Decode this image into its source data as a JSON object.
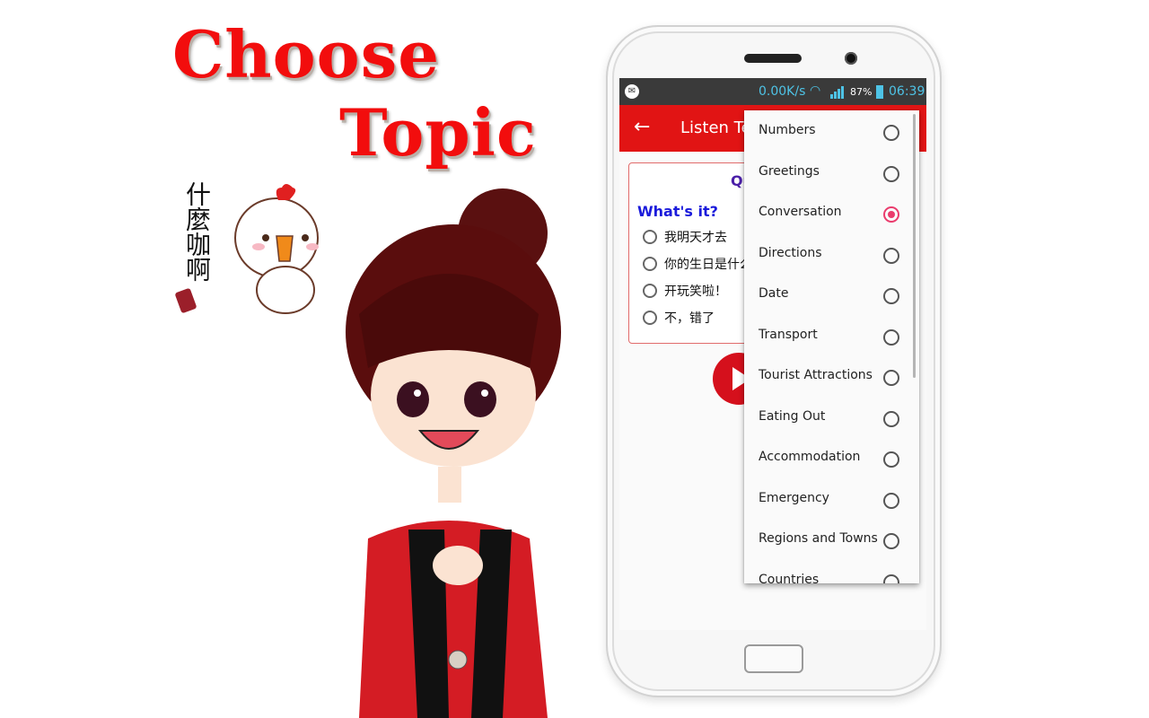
{
  "headline": {
    "line1": "Choose",
    "line2": "Topic"
  },
  "sticker": {
    "chick_text": "什麼咖啊"
  },
  "status_bar": {
    "speed": "0.00K/s",
    "battery_pct": "87%",
    "time": "06:39",
    "icons": [
      "messenger-icon",
      "wifi-icon",
      "signal-icon",
      "battery-icon"
    ]
  },
  "app_bar": {
    "back_icon": "←",
    "title": "Listen Test"
  },
  "quiz": {
    "heading": "Quiz",
    "question": "What's it?",
    "options": [
      "我明天才去",
      "你的生日是什么时候",
      "开玩笑啦！",
      "不，错了"
    ]
  },
  "topics_dropdown": {
    "selected": "Conversation",
    "items": [
      {
        "label": "Numbers",
        "checked": false
      },
      {
        "label": "Greetings",
        "checked": false
      },
      {
        "label": "Conversation",
        "checked": true
      },
      {
        "label": "Directions",
        "checked": false
      },
      {
        "label": "Date",
        "checked": false
      },
      {
        "label": "Transport",
        "checked": false
      },
      {
        "label": "Tourist Attractions",
        "checked": false
      },
      {
        "label": "Eating Out",
        "checked": false
      },
      {
        "label": "Accommodation",
        "checked": false
      },
      {
        "label": "Emergency",
        "checked": false
      },
      {
        "label": "Regions and Towns",
        "checked": false
      },
      {
        "label": "Countries",
        "checked": false
      }
    ]
  },
  "colors": {
    "accent_red": "#e11414",
    "radio_pink": "#ea3c6d",
    "status_cyan": "#4ec3e6",
    "question_blue": "#1a1adb"
  }
}
